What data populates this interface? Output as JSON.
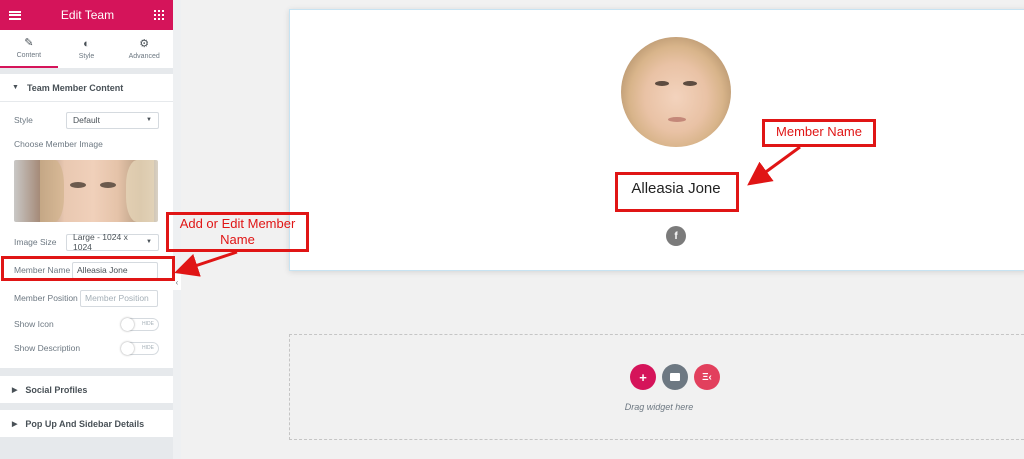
{
  "panel": {
    "title": "Edit Team",
    "tabs": [
      {
        "label": "Content",
        "icon": "pencil-icon"
      },
      {
        "label": "Style",
        "icon": "half-circle-icon"
      },
      {
        "label": "Advanced",
        "icon": "gear-icon"
      }
    ],
    "section_team": "Team Member Content",
    "style_label": "Style",
    "style_value": "Default",
    "choose_image_label": "Choose Member Image",
    "image_size_label": "Image Size",
    "image_size_value": "Large - 1024 x 1024",
    "member_name_label": "Member Name",
    "member_name_value": "Alleasia Jone",
    "member_position_label": "Member Position",
    "member_position_placeholder": "Member Position",
    "show_icon_label": "Show Icon",
    "show_description_label": "Show Description",
    "toggle_text": "HIDE",
    "section_social": "Social Profiles",
    "section_popup": "Pop Up And Sidebar Details"
  },
  "preview": {
    "member_name": "Alleasia Jone",
    "social_icon": "f"
  },
  "dropzone": {
    "text": "Drag widget here"
  },
  "annotations": {
    "edit_member_name": "Add or Edit Member Name",
    "member_name": "Member Name"
  },
  "colors": {
    "accent": "#d5145a",
    "annotation": "#e01515",
    "folder_button": "#6d7882",
    "ek_button": "#e2405d"
  }
}
